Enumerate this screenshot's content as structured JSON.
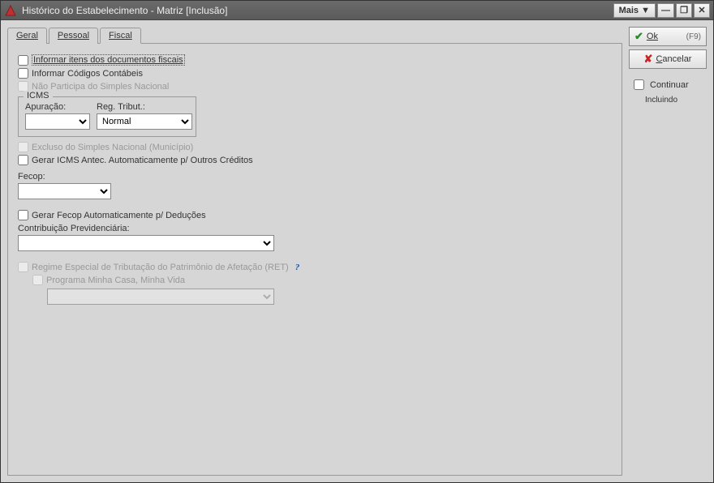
{
  "window": {
    "title": "Histórico do Estabelecimento - Matriz [Inclusão]"
  },
  "titlebar_buttons": {
    "mais": "Mais ▼",
    "minimize": "—",
    "maximize": "❐",
    "close": "✕"
  },
  "tabs": {
    "geral": "Geral",
    "pessoal": "Pessoal",
    "fiscal": "Fiscal"
  },
  "fiscal": {
    "informar_itens": "Informar itens dos documentos fiscais",
    "informar_codigos": "Informar Códigos Contábeis",
    "nao_participa_simples": "Não Participa do Simples Nacional",
    "icms": {
      "legend": "ICMS",
      "apuracao_label": "Apuração:",
      "apuracao_value": "",
      "reg_tribut_label": "Reg. Tribut.:",
      "reg_tribut_value": "Normal"
    },
    "excluso_simples": "Excluso do Simples Nacional (Município)",
    "gerar_icms_antec": "Gerar ICMS Antec. Automaticamente p/ Outros Créditos",
    "fecop_label": "Fecop:",
    "fecop_value": "",
    "gerar_fecop": "Gerar Fecop Automaticamente p/ Deduções",
    "contribuicao_label": "Contribuição Previdenciária:",
    "contribuicao_value": "",
    "ret_label": "Regime Especial de Tributação do Patrimônio de Afetação (RET)",
    "programa_minha_casa": "Programa Minha Casa, Minha Vida",
    "programa_value": ""
  },
  "actions": {
    "ok_label": "Ok",
    "ok_shortcut": "(F9)",
    "cancelar_label": "Cancelar",
    "continuar_label": "Continuar",
    "continuar_sub": "Incluindo"
  }
}
